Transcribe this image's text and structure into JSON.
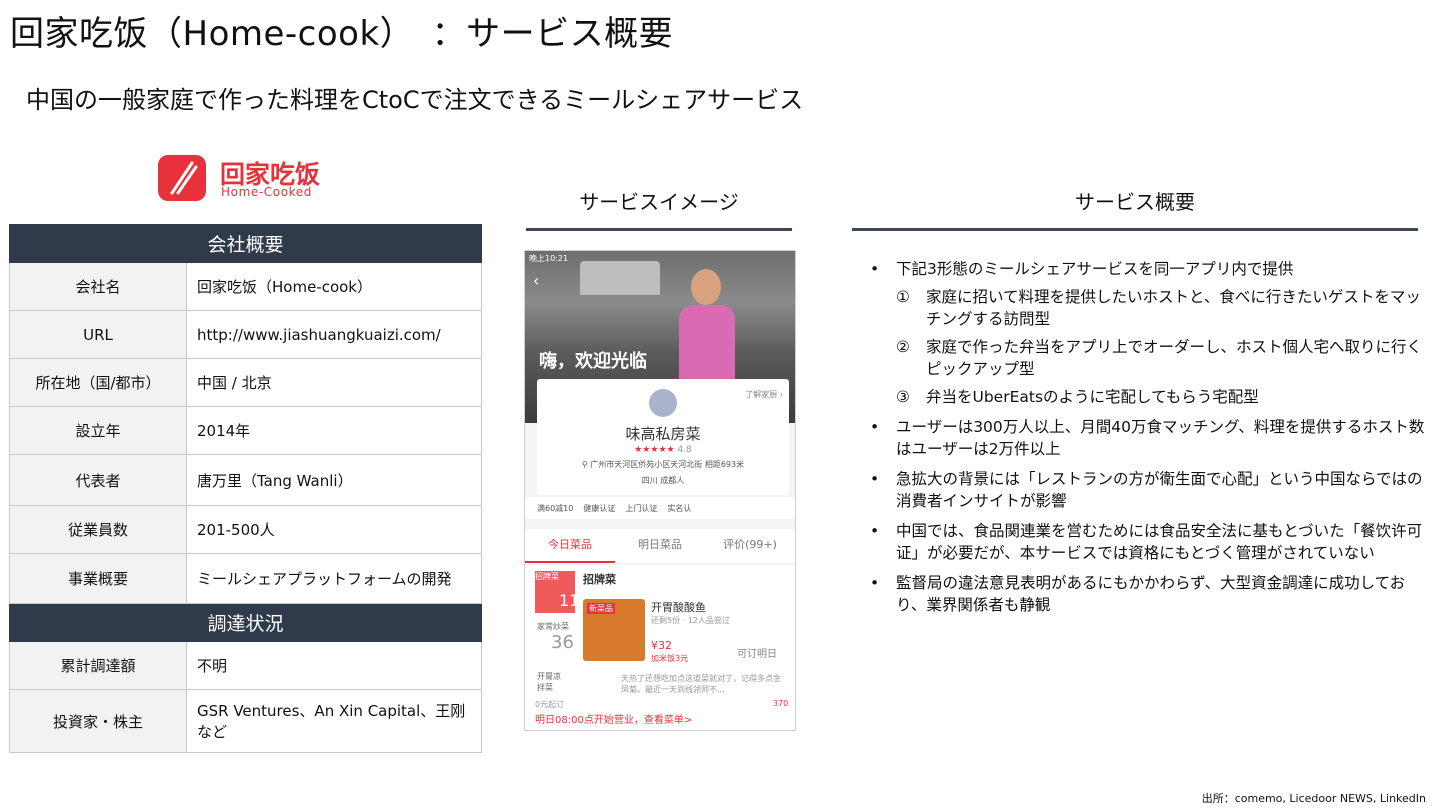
{
  "title": "回家吃饭（Home-cook）　：サービス概要",
  "subtitle": "中国の一般家庭で作った料理をCtoCで注文できるミールシェアサービス",
  "logo": {
    "zh": "回家吃饭",
    "en": "Home-Cooked"
  },
  "company": {
    "header": "会社概要",
    "rows": [
      {
        "k": "会社名",
        "v": "回家吃饭（Home-cook）"
      },
      {
        "k": "URL",
        "v": "http://www.jiashuangkuaizi.com/"
      },
      {
        "k": "所在地（国/都市）",
        "v": "中国 / 北京"
      },
      {
        "k": "設立年",
        "v": "2014年"
      },
      {
        "k": "代表者",
        "v": "唐万里（Tang Wanli）"
      },
      {
        "k": "従業員数",
        "v": "201-500人"
      },
      {
        "k": "事業概要",
        "v": "ミールシェアプラットフォームの開発"
      }
    ]
  },
  "funding": {
    "header": "調達状況",
    "rows": [
      {
        "k": "累計調達額",
        "v": "不明"
      },
      {
        "k": "投資家・株主",
        "v": "GSR Ventures、An Xin Capital、王刚 など"
      }
    ]
  },
  "image_heading": "サービスイメージ",
  "overview_heading": "サービス概要",
  "phone": {
    "status": "晚上10:21",
    "welcome": "嗨，欢迎光临",
    "more": "了解家厨 ›",
    "shop": "味高私房菜",
    "rating": "4.8",
    "address": "广州市天河区侨苑小区天河北街 相距693米",
    "city": "四川 成都人",
    "badges": [
      "满60减10",
      "健康认证",
      "上门认证",
      "实名认"
    ],
    "tabs": [
      "今日菜品",
      "明日菜品",
      "评价(99+)"
    ],
    "cat1": "招牌菜",
    "cat1_count": "11",
    "cat2": "家常炒菜",
    "cat2_count": "36",
    "cat3": "开胃凉拌菜",
    "section": "招牌菜",
    "tag": "新菜品",
    "dish": "开胃酸酸鱼",
    "dish_meta": "还剩5份 · 12人品尝过",
    "price": "¥32",
    "extra": "加米饭3元",
    "order": "可订明日",
    "review": "天热了还想吃加点这道菜就对了，记得多点金凤菊。最近一天到线领师不...",
    "start": "0元起订",
    "open": "明日08:00点开始营业，查看菜单>",
    "likes": "370"
  },
  "overview": {
    "bullets": [
      {
        "text": "下記3形態のミールシェアサービスを同一アプリ内で提供",
        "subs": [
          {
            "n": "①",
            "t": "家庭に招いて料理を提供したいホストと、食べに行きたいゲストをマッチングする訪問型"
          },
          {
            "n": "②",
            "t": "家庭で作った弁当をアプリ上でオーダーし、ホスト個人宅へ取りに行くピックアップ型"
          },
          {
            "n": "③",
            "t": "弁当をUberEatsのように宅配してもらう宅配型"
          }
        ]
      },
      {
        "text": "ユーザーは300万人以上、月間40万食マッチング、料理を提供するホスト数はユーザーは2万件以上"
      },
      {
        "text": "急拡大の背景には「レストランの方が衛生面で心配」という中国ならではの消費者インサイトが影響"
      },
      {
        "text": "中国では、食品関連業を営むためには食品安全法に基もとづいた「餐饮许可证」が必要だが、本サービスでは資格にもとづく管理がされていない"
      },
      {
        "text": "監督局の違法意見表明があるにもかかわらず、大型資金調達に成功しており、業界関係者も静観"
      }
    ]
  },
  "source": "出所：comemo, Licedoor NEWS,  LinkedIn",
  "colors": {
    "brand": "#e8323b",
    "header_bg": "#2f3a4a"
  }
}
